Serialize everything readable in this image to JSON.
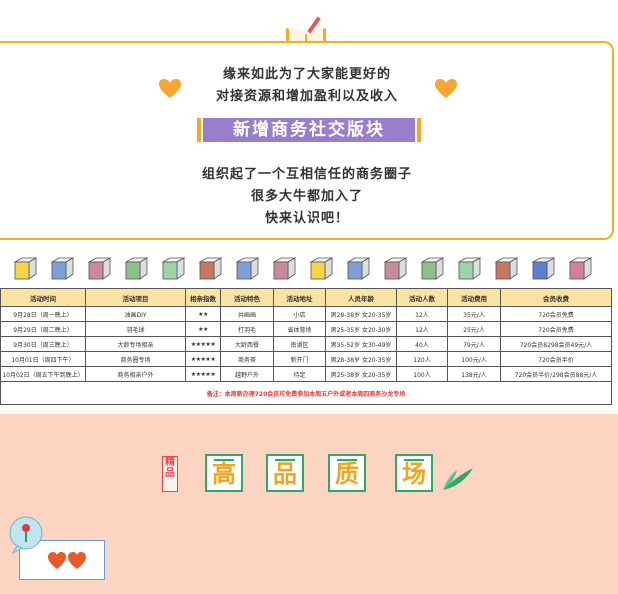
{
  "intro": {
    "line1": "缘来如此为了大家能更好的",
    "line2": "对接资源和增加盈利以及收入",
    "banner": "新增商务社交版块",
    "line3": "组织起了一个互相信任的商务圈子",
    "line4": "很多大牛都加入了",
    "line5": "快来认识吧！"
  },
  "cube_colors": [
    "#f3d64a",
    "#7f9fd6",
    "#c98a9a",
    "#8fbf8a",
    "#9fd3a8",
    "#c47860",
    "#7f9fd6",
    "#c98a9a",
    "#f3d64a",
    "#7f9fd6",
    "#c98a9a",
    "#8fbf8a",
    "#9fd3a8",
    "#c47860",
    "#5a7fd0",
    "#d5809a"
  ],
  "table": {
    "headers": [
      "活动时间",
      "活动项目",
      "相亲指数",
      "活动特色",
      "活动地址",
      "人员年龄",
      "活动人数",
      "活动费用",
      "会员收费"
    ],
    "rows": [
      [
        "9月28日（周一晚上）",
        "油画DIY",
        "★★",
        "共画画",
        "小店",
        "男28-38岁 女20-35岁",
        "12人",
        "35元/人",
        "720会员免费"
      ],
      [
        "9月29日（周二晚上）",
        "羽毛球",
        "★★",
        "打羽毛",
        "省体育场",
        "男25-35岁 女20-30岁",
        "12人",
        "25元/人",
        "720会员免费"
      ],
      [
        "9月30日（周三晚上）",
        "大龄专场相亲",
        "★★★★★",
        "大龄西餐",
        "南湖区",
        "男35-52岁 女30-49岁",
        "40人",
        "79元/人",
        "720会员8298会员49元/人"
      ],
      [
        "10月01日（周四下午）",
        "商务圈专场",
        "★★★★★",
        "商务茶",
        "新开门",
        "男28-38岁 女20-35岁",
        "120人",
        "100元/人",
        "720会员半价"
      ],
      [
        "10月02日（周五下午到晚上）",
        "商务相亲户外",
        "★★★★★",
        "越野户外",
        "待定",
        "男25-38岁 女20-35岁",
        "100人",
        "138元/人",
        "720会员半价/298会员88元/人"
      ]
    ],
    "note": "备注：本周新办理720会员可免费参加本周五户外或者本周四商务沙龙专场"
  },
  "bottom": {
    "stamp": "精品",
    "quality_chars": [
      "高",
      "品",
      "质",
      "场"
    ],
    "accent_green": "#2fa86b",
    "accent_orange": "#f2a51b"
  }
}
